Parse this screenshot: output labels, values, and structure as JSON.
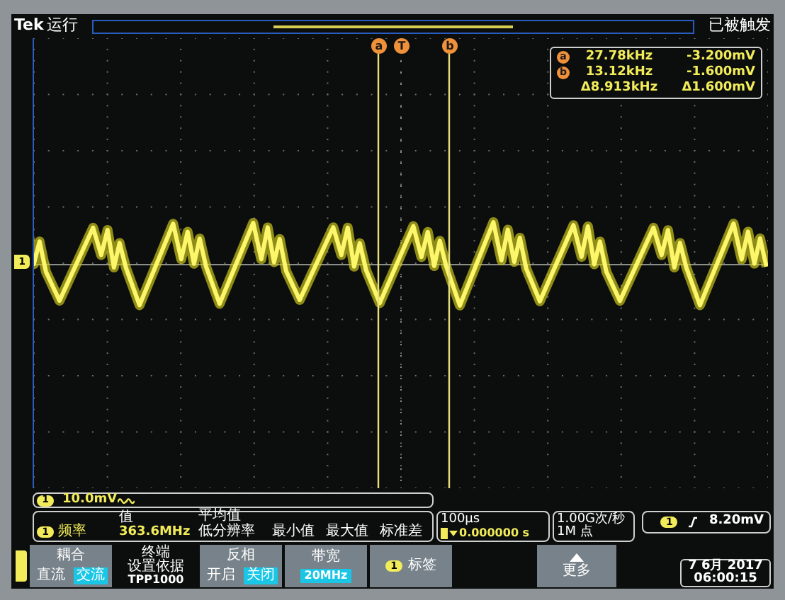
{
  "header": {
    "brand": "Tek",
    "run_state": "运行",
    "trigger_state": "已被触发"
  },
  "cursor_markers": [
    {
      "label": "a"
    },
    {
      "label": "T"
    },
    {
      "label": "b"
    }
  ],
  "cursor_readout": [
    {
      "marker": "a",
      "frequency": "27.78kHz",
      "voltage": "-3.200mV"
    },
    {
      "marker": "b",
      "frequency": "13.12kHz",
      "voltage": "-1.600mV"
    },
    {
      "frequency": "Δ8.913kHz",
      "voltage": "Δ1.600mV"
    }
  ],
  "channel_marker": "1",
  "channel": {
    "number": "1",
    "scale": "10.0mV"
  },
  "measurement": {
    "channel": "1",
    "name": "频率",
    "columns": [
      "值",
      "平均值",
      "最小值",
      "最大值",
      "标准差"
    ],
    "value": "363.6MHz",
    "note": "低分辨率"
  },
  "horizontal": {
    "scale": "100µs",
    "position": "0.000000 s"
  },
  "acquisition": {
    "rate": "1.00G次/秒",
    "points": "1M 点"
  },
  "trigger": {
    "channel": "1",
    "level": "8.20mV"
  },
  "menu": [
    {
      "kind": "toggle",
      "title": "耦合",
      "options": [
        {
          "label": "直流",
          "selected": false
        },
        {
          "label": "交流",
          "selected": true
        }
      ]
    },
    {
      "kind": "info",
      "lines": [
        "终端",
        "设置依据",
        "TPP1000"
      ]
    },
    {
      "kind": "toggle",
      "title": "反相",
      "options": [
        {
          "label": "开启",
          "selected": false
        },
        {
          "label": "关闭",
          "selected": true
        }
      ]
    },
    {
      "kind": "value",
      "title": "带宽",
      "value": "20MHz"
    },
    {
      "kind": "badge",
      "badge": "1",
      "title": "标签"
    }
  ],
  "more_button": {
    "label": "更多"
  },
  "clock": {
    "date": "7 6月 2017",
    "time": "06:00:15"
  }
}
